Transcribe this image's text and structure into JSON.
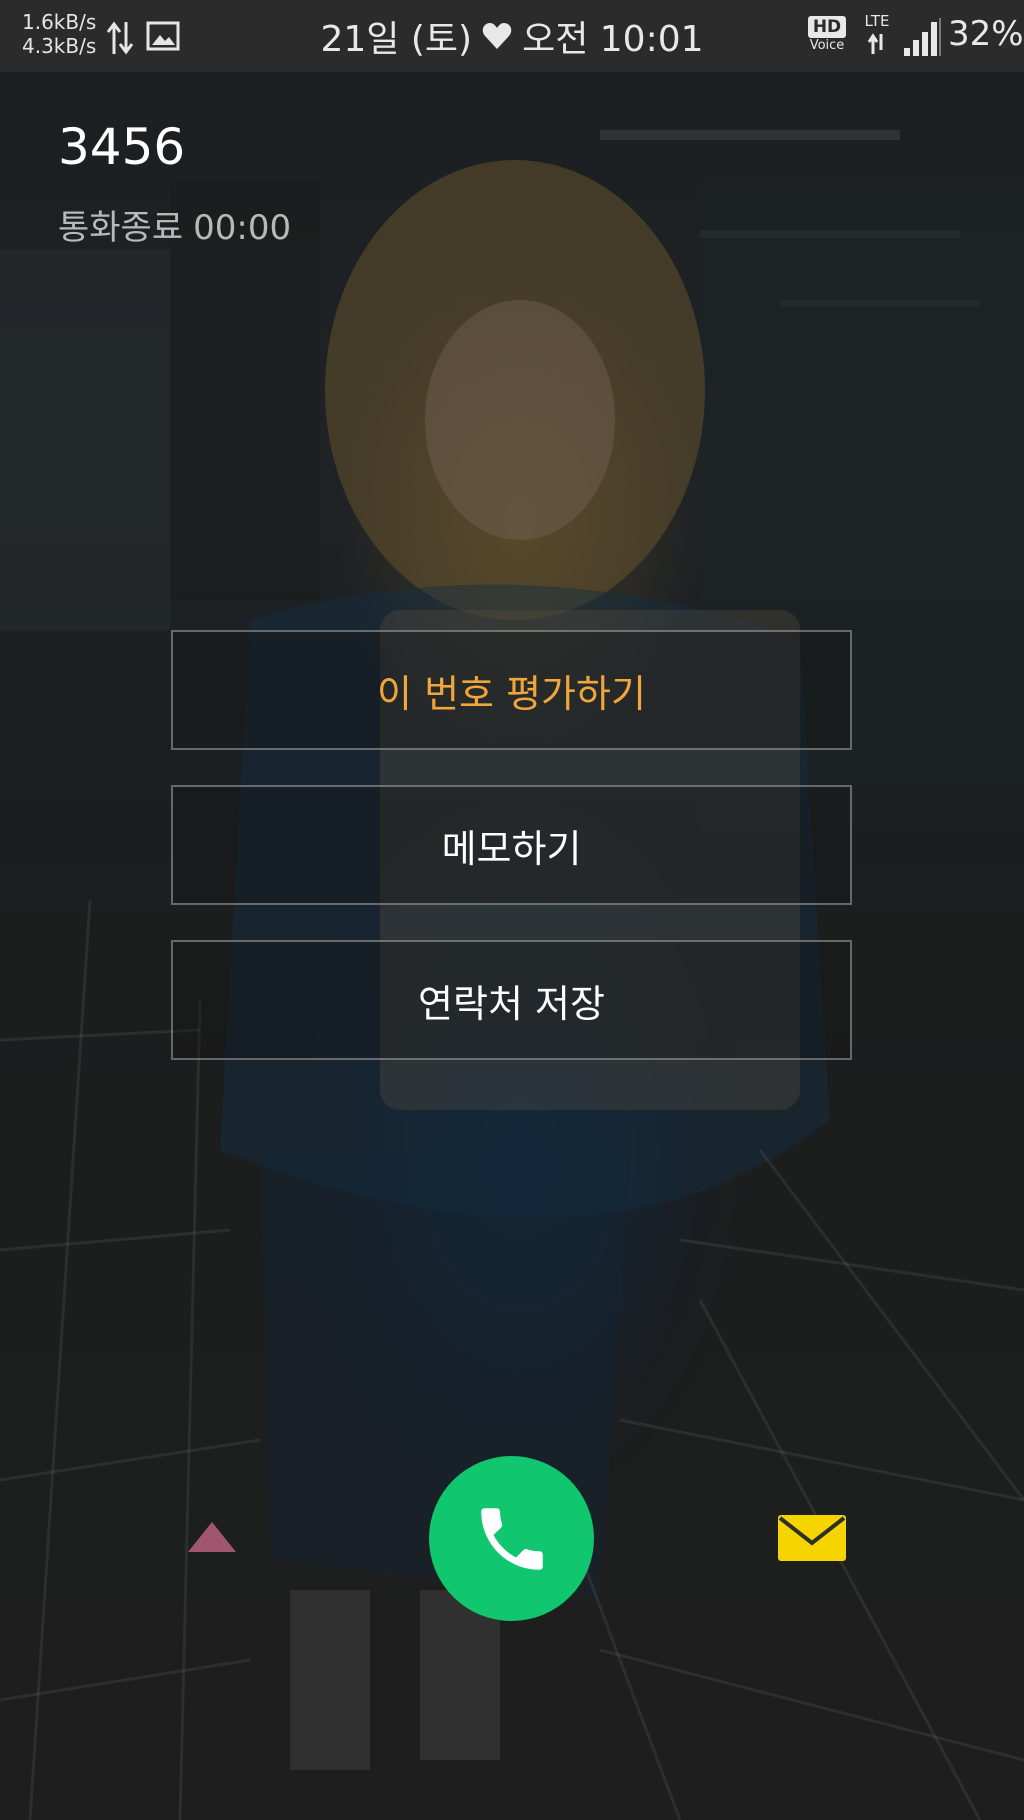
{
  "status_bar": {
    "net_up": "1.6kB/s",
    "net_down": "4.3kB/s",
    "date": "21일 (토)",
    "time": "오전 10:01",
    "hd_label": "HD",
    "voice_label": "Voice",
    "lte_label": "LTE",
    "battery": "32%",
    "icons": [
      "updown-arrows-icon",
      "image-icon",
      "heart-icon",
      "hd-voice-icon",
      "lte-icon",
      "signal-icon"
    ]
  },
  "call": {
    "number": "3456",
    "status_label": "통화종료",
    "duration": "00:00"
  },
  "actions": {
    "rate_label": "이 번호 평가하기",
    "memo_label": "메모하기",
    "save_label": "연락처 저장"
  },
  "controls": {
    "icons": [
      "up-arrow-icon",
      "phone-icon",
      "mail-icon"
    ]
  },
  "colors": {
    "accent_orange": "#f0a63a",
    "call_green": "#10c66e",
    "mail_yellow": "#f5d400",
    "up_arrow": "#a0566e"
  }
}
